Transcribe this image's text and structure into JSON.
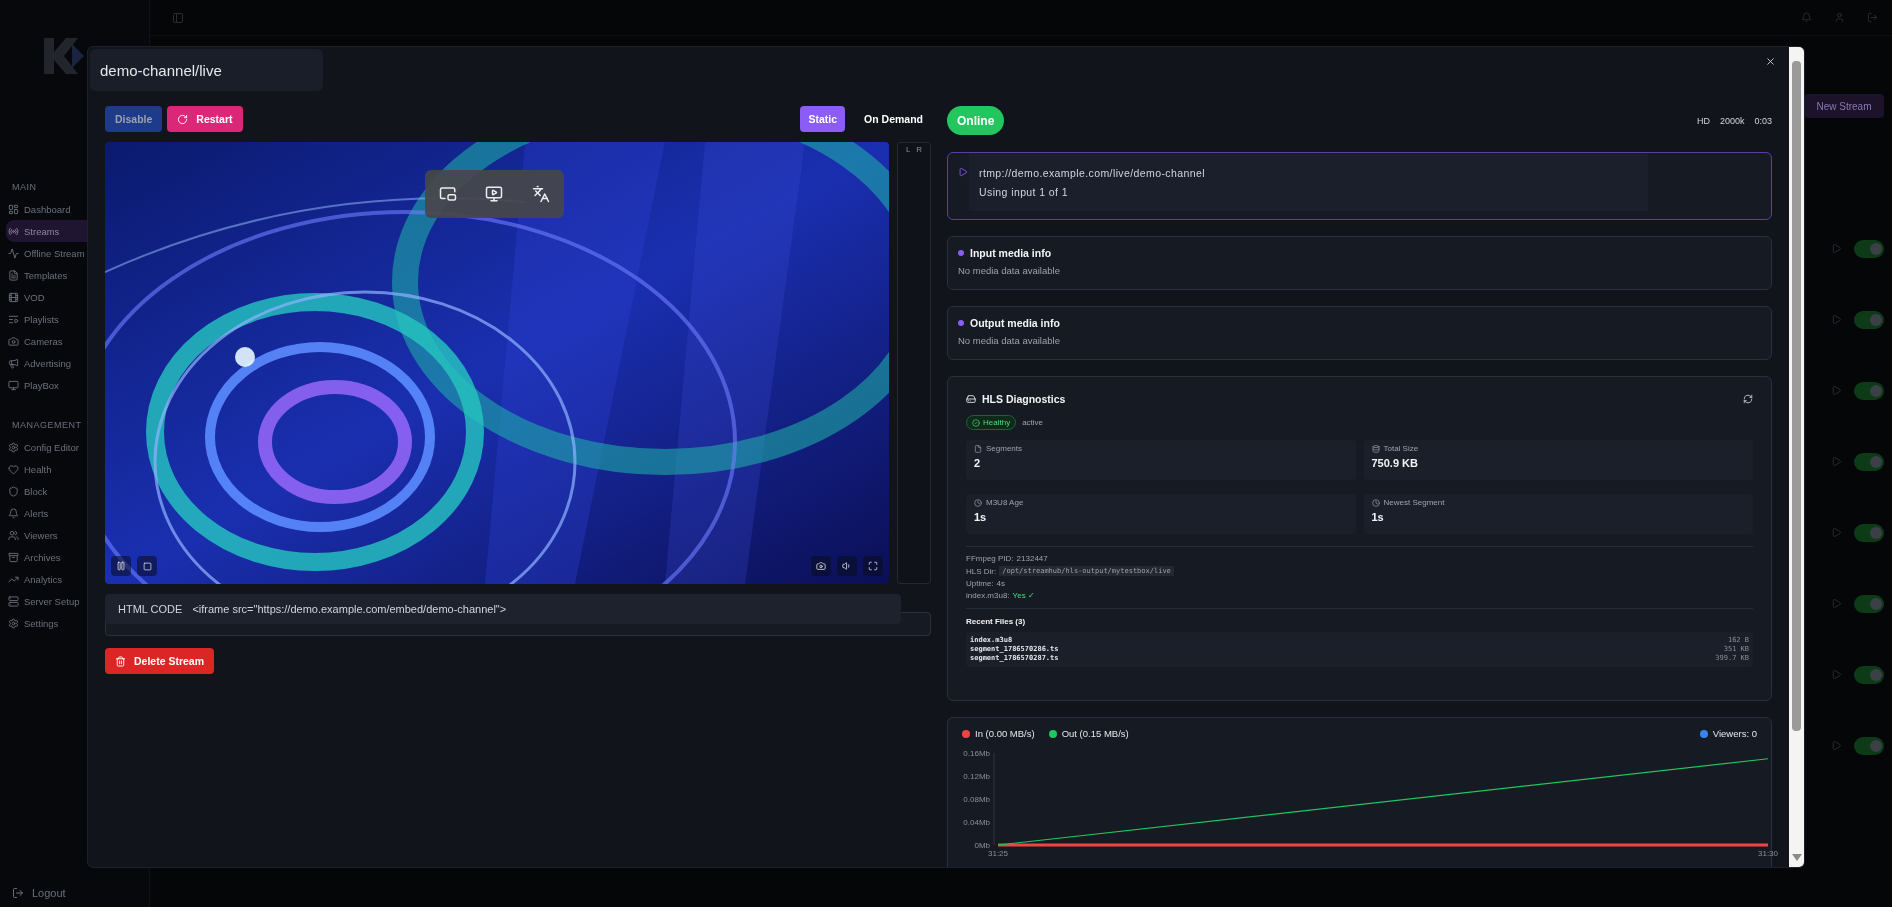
{
  "sidebar": {
    "sections": [
      {
        "heading": "MAIN",
        "items": [
          {
            "label": "Dashboard",
            "selected": false
          },
          {
            "label": "Streams",
            "selected": true
          },
          {
            "label": "Offline Stream",
            "selected": false
          },
          {
            "label": "Templates",
            "selected": false
          },
          {
            "label": "VOD",
            "selected": false
          },
          {
            "label": "Playlists",
            "selected": false
          },
          {
            "label": "Cameras",
            "selected": false
          },
          {
            "label": "Advertising",
            "selected": false
          },
          {
            "label": "PlayBox",
            "selected": false
          }
        ]
      },
      {
        "heading": "MANAGEMENT",
        "items": [
          {
            "label": "Config Editor",
            "selected": false
          },
          {
            "label": "Health",
            "selected": false
          },
          {
            "label": "Block",
            "selected": false
          },
          {
            "label": "Alerts",
            "selected": false
          },
          {
            "label": "Viewers",
            "selected": false
          },
          {
            "label": "Archives",
            "selected": false
          },
          {
            "label": "Analytics",
            "selected": false
          },
          {
            "label": "Server Setup",
            "selected": false
          },
          {
            "label": "Settings",
            "selected": false
          }
        ]
      }
    ],
    "logout": "Logout"
  },
  "background": {
    "new_stream": "New Stream",
    "rows": [
      {
        "on": true
      },
      {
        "on": true
      },
      {
        "on": true
      },
      {
        "on": true
      },
      {
        "on": true
      },
      {
        "on": true
      },
      {
        "on": true
      },
      {
        "on": true
      }
    ]
  },
  "modal": {
    "title": "demo-channel/live",
    "disable": "Disable",
    "restart": "Restart",
    "modes": [
      {
        "label": "Static",
        "selected": true
      },
      {
        "label": "On Demand",
        "selected": false
      }
    ],
    "meter_labels": [
      "L",
      "R"
    ],
    "embed": {
      "label": "HTML CODE",
      "code": "<iframe src=\"https://demo.example.com/embed/demo-channel\">"
    },
    "delete": "Delete Stream",
    "status": "Online",
    "stream_meta": [
      "HD",
      "2000k",
      "0:03"
    ],
    "input": {
      "url": "rtmp://demo.example.com/live/demo-channel",
      "note": "Using input 1 of 1"
    },
    "media_cards": [
      {
        "title": "Input media info",
        "text": "No media data available"
      },
      {
        "title": "Output media info",
        "text": "No media data available"
      }
    ],
    "hls": {
      "title": "HLS Diagnostics",
      "health": "Healthy",
      "state": "active",
      "stats": [
        {
          "kind": "file",
          "label": "Segments",
          "value": "2"
        },
        {
          "kind": "disk",
          "label": "Total Size",
          "value": "750.9 KB"
        },
        {
          "kind": "clock",
          "label": "M3U8 Age",
          "value": "1s"
        },
        {
          "kind": "clock",
          "label": "Newest Segment",
          "value": "1s"
        }
      ],
      "info": [
        {
          "kind": "plain",
          "label": "FFmpeg PID:",
          "value": "2132447"
        },
        {
          "kind": "code",
          "label": "HLS Dir:",
          "value": "/opt/streamhub/hls-output/mytestbox/live"
        },
        {
          "kind": "plain",
          "label": "Uptime:",
          "value": "4s"
        },
        {
          "kind": "ok",
          "label": "index.m3u8:",
          "value": "Yes ✓"
        }
      ],
      "files_title": "Recent Files (3)",
      "files": [
        {
          "name": "index.m3u8",
          "size": "162 B"
        },
        {
          "name": "segment_1786570286.ts",
          "size": "351 KB"
        },
        {
          "name": "segment_1786570287.ts",
          "size": "399.7 KB"
        }
      ]
    },
    "chart": {
      "viewers": {
        "label": "Viewers: 0",
        "color": "#3b82f6"
      },
      "chart_data": {
        "type": "line",
        "categories": [
          "31:25",
          "31:30"
        ],
        "series": [
          {
            "name": "In (0.00 MB/s)",
            "color": "#ef4444",
            "values": [
              0,
              0
            ]
          },
          {
            "name": "Out (0.15 MB/s)",
            "color": "#22c55e",
            "values": [
              0,
              0.15
            ]
          }
        ],
        "ylim": [
          0,
          0.16
        ],
        "yticks": [
          {
            "value": 0,
            "label": "0Mb"
          },
          {
            "value": 0.04,
            "label": "0.04Mb"
          },
          {
            "value": 0.08,
            "label": "0.08Mb"
          },
          {
            "value": 0.12,
            "label": "0.12Mb"
          },
          {
            "value": 0.16,
            "label": "0.16Mb"
          }
        ]
      }
    }
  }
}
